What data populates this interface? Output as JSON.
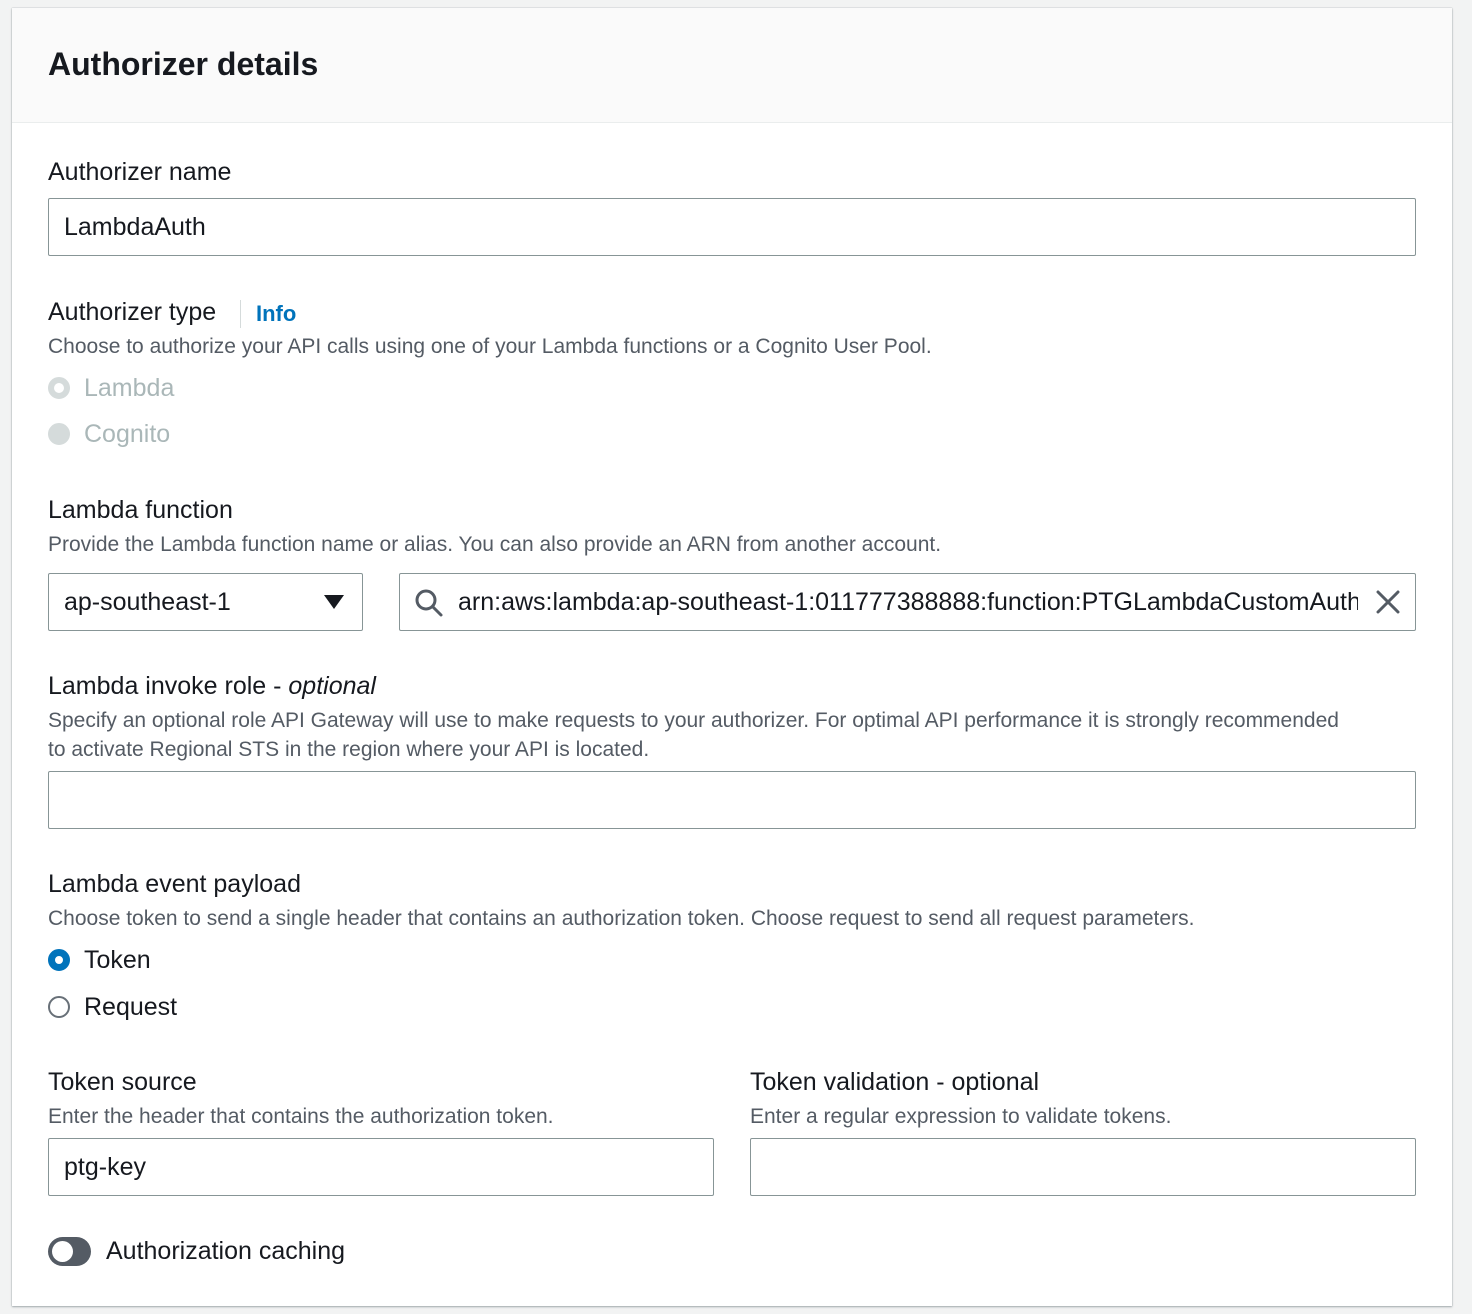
{
  "panel": {
    "title": "Authorizer details"
  },
  "authorizer_name": {
    "label": "Authorizer name",
    "value": "LambdaAuth"
  },
  "authorizer_type": {
    "label": "Authorizer type",
    "info_link": "Info",
    "description": "Choose to authorize your API calls using one of your Lambda functions or a Cognito User Pool.",
    "options": [
      {
        "label": "Lambda",
        "selected": true,
        "disabled": true
      },
      {
        "label": "Cognito",
        "selected": false,
        "disabled": true
      }
    ]
  },
  "lambda_function": {
    "label": "Lambda function",
    "description": "Provide the Lambda function name or alias. You can also provide an ARN from another account.",
    "region": "ap-southeast-1",
    "value": "arn:aws:lambda:ap-southeast-1:011777388888:function:PTGLambdaCustomAuth"
  },
  "invoke_role": {
    "label": "Lambda invoke role - ",
    "label_optional": "optional",
    "description_line1": "Specify an optional role API Gateway will use to make requests to your authorizer. For optimal API performance it is strongly recommended",
    "description_line2": "to activate Regional STS in the region where your API is located.",
    "value": ""
  },
  "event_payload": {
    "label": "Lambda event payload",
    "description": "Choose token to send a single header that contains an authorization token. Choose request to send all request parameters.",
    "options": [
      {
        "label": "Token",
        "selected": true
      },
      {
        "label": "Request",
        "selected": false
      }
    ]
  },
  "token_source": {
    "label": "Token source",
    "description": "Enter the header that contains the authorization token.",
    "value": "ptg-key"
  },
  "token_validation": {
    "label": "Token validation - optional",
    "description": "Enter a regular expression to validate tokens.",
    "value": ""
  },
  "caching": {
    "label": "Authorization caching",
    "enabled": false
  },
  "colors": {
    "accent": "#0073bb",
    "text": "#16191f",
    "secondary_text": "#545b64",
    "border": "#879596"
  }
}
